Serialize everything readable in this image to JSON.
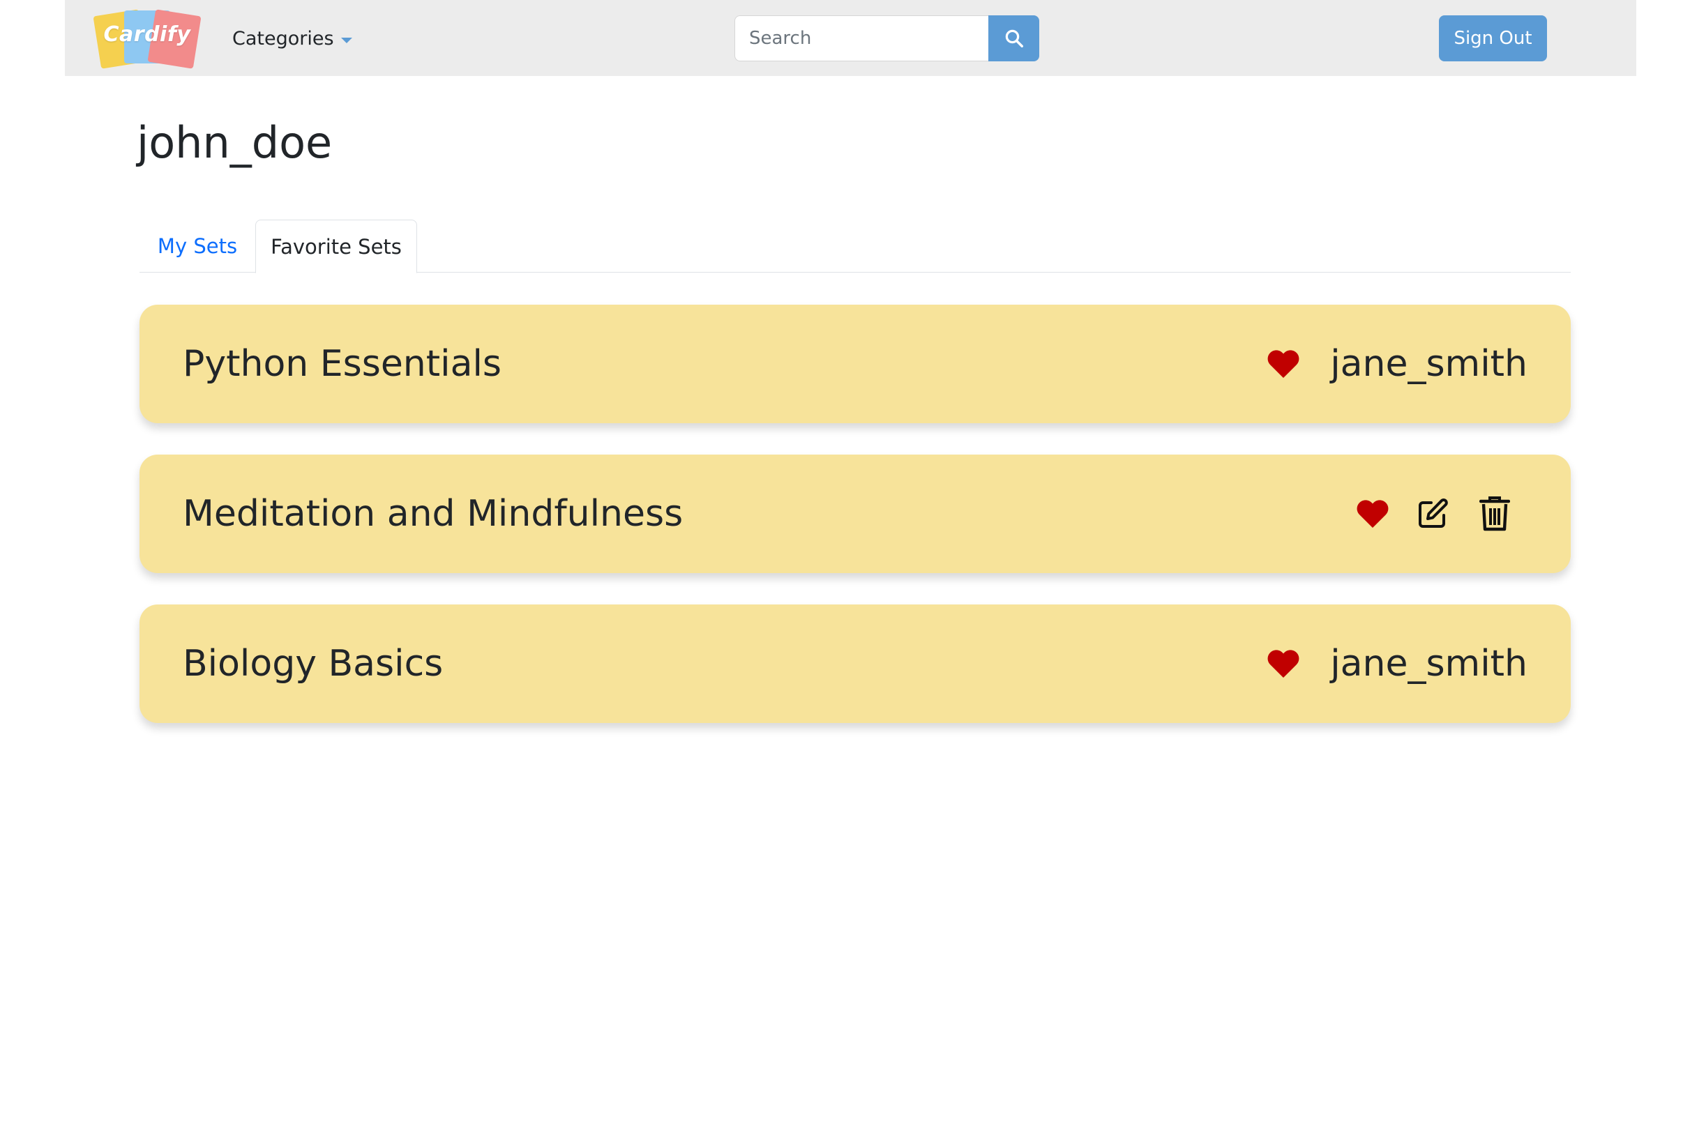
{
  "header": {
    "logo_text": "Cardify",
    "categories_label": "Categories",
    "search_placeholder": "Search",
    "signout_label": "Sign Out"
  },
  "profile": {
    "username": "john_doe"
  },
  "tabs": [
    {
      "label": "My Sets",
      "active": false
    },
    {
      "label": "Favorite Sets",
      "active": true
    }
  ],
  "sets": [
    {
      "title": "Python Essentials",
      "author": "jane_smith",
      "owned": false
    },
    {
      "title": "Meditation and Mindfulness",
      "author": "",
      "owned": true
    },
    {
      "title": "Biology Basics",
      "author": "jane_smith",
      "owned": false
    }
  ],
  "colors": {
    "navbar_bg": "#ececec",
    "accent": "#5b9bd5",
    "card_bg": "#f7e39a",
    "heart": "#c00000",
    "user_icon": "#0d6efd",
    "tab_link": "#0d6efd",
    "logo_yellow": "#f5d04f",
    "logo_blue": "#8ec8f2",
    "logo_red": "#f28b8b"
  },
  "icons": {
    "search": "search-icon",
    "user": "user-icon",
    "favorite": "heart-icon",
    "edit": "edit-icon",
    "delete": "trash-icon"
  }
}
